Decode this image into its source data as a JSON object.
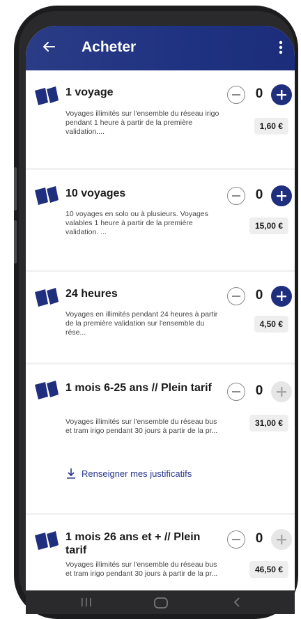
{
  "header": {
    "title": "Acheter"
  },
  "products": [
    {
      "title": "1 voyage",
      "description": "Voyages illimités sur l'ensemble du réseau irigo pendant 1 heure à partir de la première validation....",
      "quantity": "0",
      "price": "1,60 €",
      "add_enabled": true
    },
    {
      "title": "10 voyages",
      "description": "10 voyages en solo ou à plusieurs. Voyages valables 1 heure à partir de la première validation. ...",
      "quantity": "0",
      "price": "15,00 €",
      "add_enabled": true
    },
    {
      "title": "24 heures",
      "description": "Voyages en illimités pendant 24 heures à partir de la première validation sur l'ensemble du rése...",
      "quantity": "0",
      "price": "4,50 €",
      "add_enabled": true
    },
    {
      "title": "1 mois 6-25 ans // Plein tarif",
      "description": "Voyages illimités sur l'ensemble du réseau bus et tram irigo pendant 30 jours à partir de la pr...",
      "quantity": "0",
      "price": "31,00 €",
      "add_enabled": false,
      "link": "Renseigner mes justificatifs"
    },
    {
      "title": "1 mois 26 ans et + // Plein tarif",
      "description": "Voyages illimités sur l'ensemble du réseau bus et tram irigo pendant 30 jours à partir de la pr...",
      "quantity": "0",
      "price": "46,50 €",
      "add_enabled": false
    }
  ],
  "icons": {
    "back": "arrow-left-icon",
    "menu": "more-vertical-icon",
    "product": "ticket-icon",
    "minus": "minus-circle-icon",
    "plus": "plus-circle-icon",
    "download": "download-icon"
  },
  "colors": {
    "primary": "#1f2f7e",
    "appbar": "#22358a",
    "disabled": "#e6e6e6"
  }
}
